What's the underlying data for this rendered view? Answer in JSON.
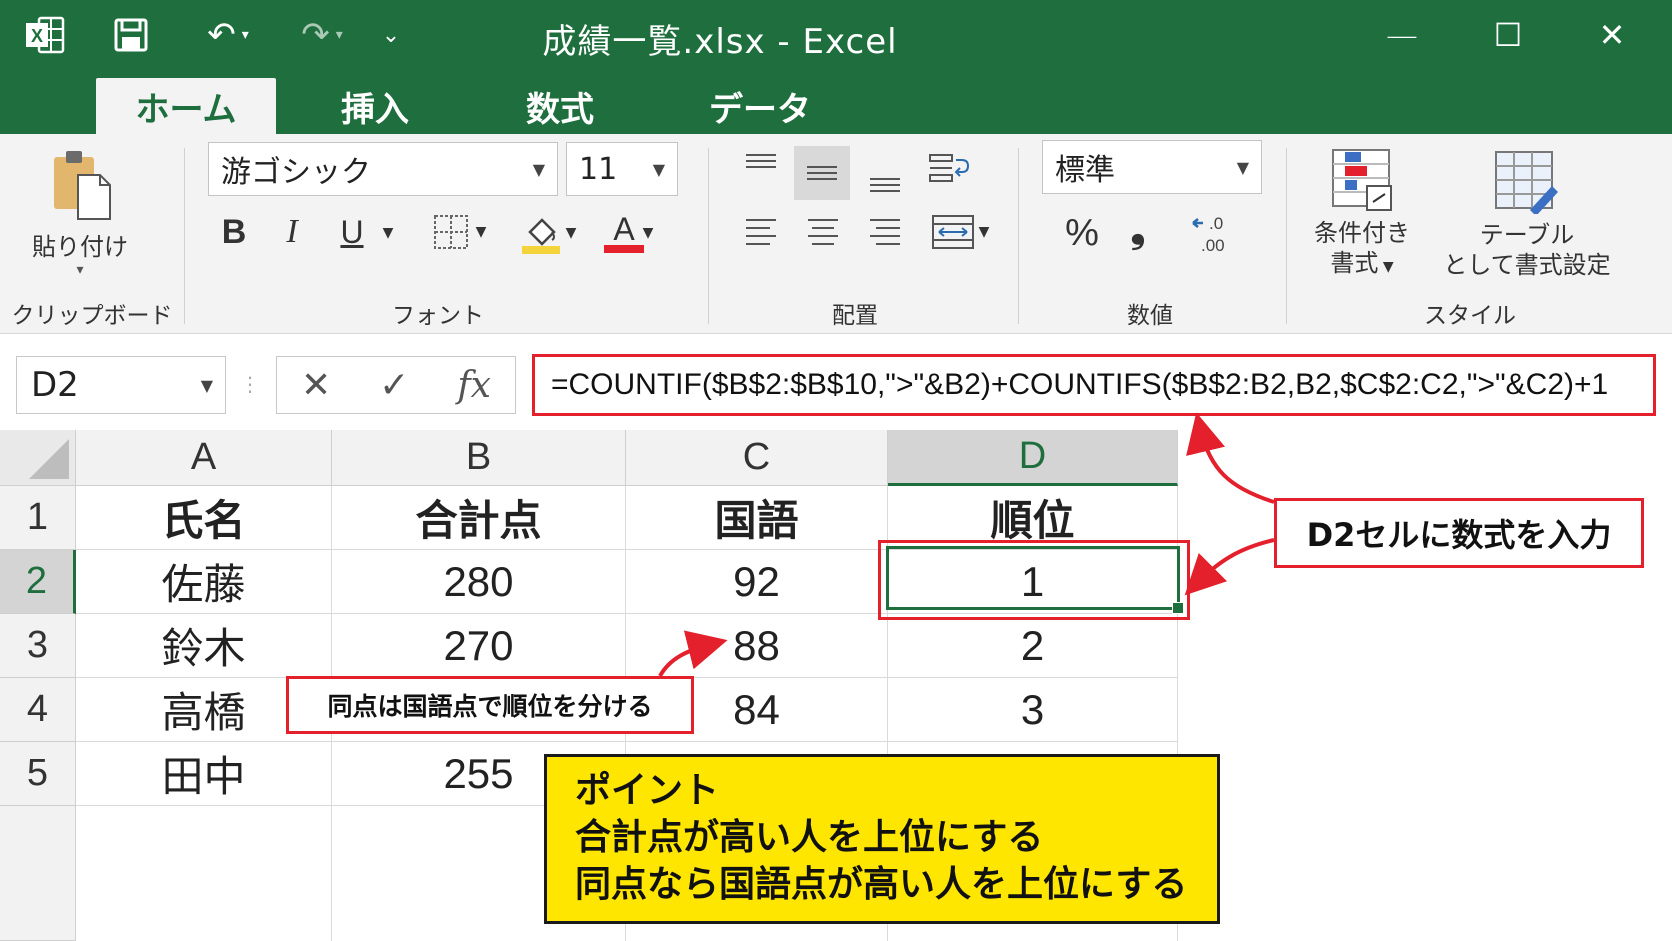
{
  "titlebar": {
    "title": "成績一覧.xlsx  -  Excel",
    "app_icon": "excel-icon",
    "undo_glyph": "↶",
    "redo_glyph": "↷",
    "qat_glyph": "⌄",
    "minimize": "—",
    "maximize": "☐",
    "close": "✕"
  },
  "tabs": [
    {
      "label": "ホーム",
      "active": true
    },
    {
      "label": "挿入",
      "active": false
    },
    {
      "label": "数式",
      "active": false
    },
    {
      "label": "データ",
      "active": false
    }
  ],
  "ribbon": {
    "clipboard": {
      "paste_label": "貼り付け",
      "group": "クリップボード"
    },
    "font": {
      "name": "游ゴシック",
      "size": "11",
      "bold": "B",
      "italic": "I",
      "underline": "U",
      "font_color_letter": "A",
      "group": "フォント"
    },
    "alignment": {
      "group": "配置"
    },
    "number": {
      "format": "標準",
      "percent": "%",
      "comma": "❟",
      "group": "数値"
    },
    "styles": {
      "conditional_line1": "条件付き",
      "conditional_line2": "書式",
      "table_line1": "テーブル",
      "table_line2": "として書式設定",
      "group": "スタイル"
    }
  },
  "formula_bar": {
    "name_box": "D2",
    "cancel": "✕",
    "enter": "✓",
    "fx": "fx",
    "formula": "=COUNTIF($B$2:$B$10,\">\"&B2)+COUNTIFS($B$2:B2,B2,$C$2:C2,\">\"&C2)+1"
  },
  "sheet": {
    "columns": [
      "A",
      "B",
      "C",
      "D"
    ],
    "rows": [
      "1",
      "2",
      "3",
      "4",
      "5"
    ],
    "header": [
      "氏名",
      "合計点",
      "国語",
      "順位"
    ],
    "data": [
      [
        "佐藤",
        "280",
        "92",
        "1"
      ],
      [
        "鈴木",
        "270",
        "88",
        "2"
      ],
      [
        "高橋",
        "",
        "84",
        "3"
      ],
      [
        "田中",
        "255",
        "",
        ""
      ]
    ]
  },
  "annotations": {
    "callout_d2": "D2セルに数式を入力",
    "callout_tie": "同点は国語点で順位を分ける",
    "point_title": "ポイント",
    "point_line1": "合計点が高い人を上位にする",
    "point_line2": "同点なら国語点が高い人を上位にする"
  },
  "colors": {
    "excel_green": "#1e6e3e",
    "annotation_red": "#e3202b",
    "point_yellow": "#ffe600"
  }
}
